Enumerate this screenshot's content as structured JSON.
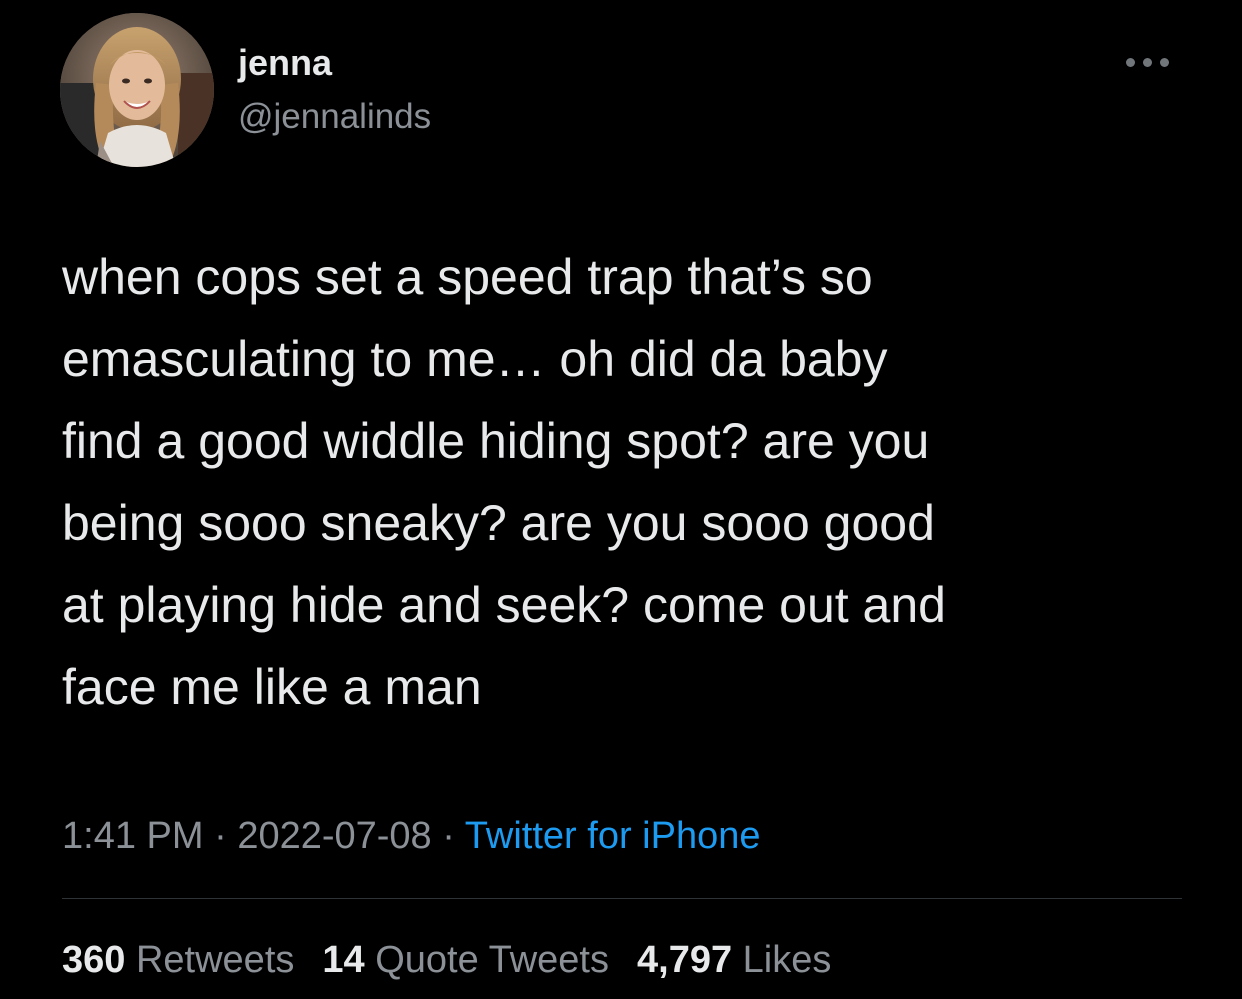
{
  "author": {
    "display_name": "jenna",
    "handle": "@jennalinds"
  },
  "tweet": {
    "text": "when cops set a speed trap that’s so\nemasculating to me… oh did da baby\nfind a good widdle hiding spot? are you\nbeing sooo sneaky? are you sooo good\nat playing hide and seek? come out and\nface me like a man"
  },
  "meta": {
    "time": "1:41 PM",
    "separator": " · ",
    "date": "2022-07-08",
    "source": "Twitter for iPhone"
  },
  "stats": {
    "retweets_count": "360",
    "retweets_label": "Retweets",
    "quotes_count": "14",
    "quotes_label": "Quote Tweets",
    "likes_count": "4,797",
    "likes_label": "Likes"
  },
  "colors": {
    "background": "#000000",
    "text": "#e7e9ea",
    "secondary": "#8b9197",
    "link": "#1d9bf0",
    "divider": "#2f3336"
  },
  "icons": {
    "more": "more-dots-icon"
  }
}
